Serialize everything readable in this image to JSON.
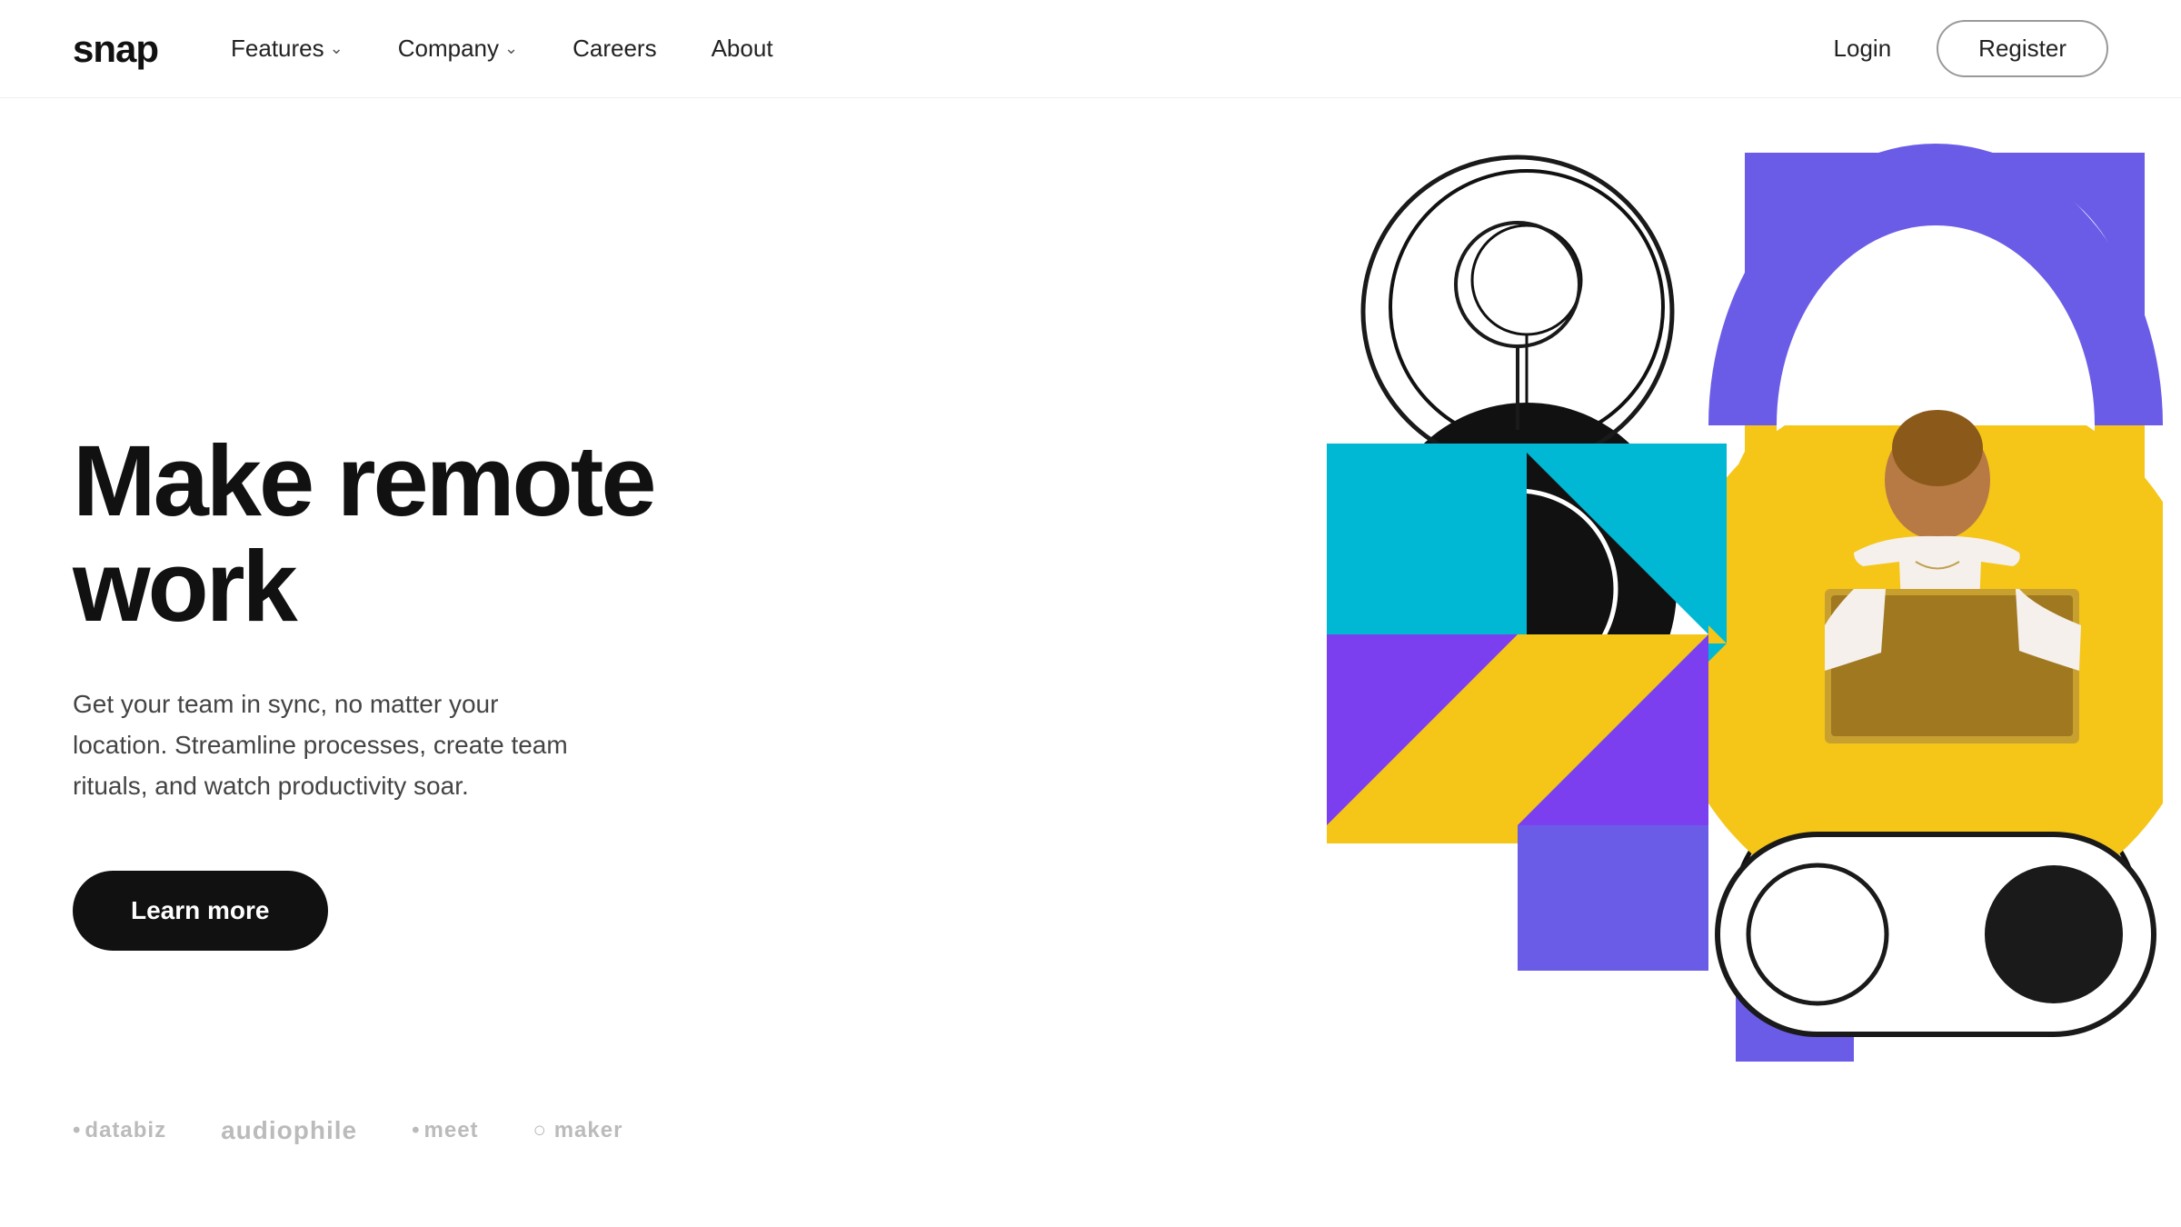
{
  "nav": {
    "logo": "snap",
    "links": [
      {
        "label": "Features",
        "hasDropdown": true
      },
      {
        "label": "Company",
        "hasDropdown": true
      },
      {
        "label": "Careers",
        "hasDropdown": false
      },
      {
        "label": "About",
        "hasDropdown": false
      }
    ],
    "actions": {
      "login": "Login",
      "register": "Register"
    }
  },
  "hero": {
    "title": "Make remote work",
    "subtitle": "Get your team in sync, no matter your location. Streamline processes, create team rituals, and watch productivity soar.",
    "cta": "Learn more"
  },
  "logos": [
    {
      "name": "databiz",
      "label": "databiz"
    },
    {
      "name": "audiophile",
      "label": "audiophile"
    },
    {
      "name": "meet",
      "label": "meet"
    },
    {
      "name": "maker",
      "label": "maker"
    }
  ],
  "colors": {
    "purple": "#6B5CE7",
    "yellow": "#F5C518",
    "cyan": "#00BCD4",
    "violet": "#8B5CF6",
    "black": "#111111",
    "accent_purple": "#6B5CE7"
  }
}
